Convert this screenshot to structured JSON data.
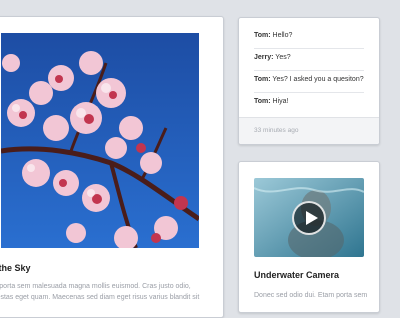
{
  "article": {
    "title": "ps in the Sky",
    "body_lines": [
      "Etam porta sem malesuada magna mollis euismod. Cras justo odio,",
      "n, egestas eget quam. Maecenas sed diam eget risus varius blandit sit"
    ]
  },
  "chat": {
    "messages": [
      {
        "sender": "Tom:",
        "text": " Hello?"
      },
      {
        "sender": "Jerry:",
        "text": " Yes?"
      },
      {
        "sender": "Tom:",
        "text": " Yes? I asked you a quesiton?"
      },
      {
        "sender": "Tom:",
        "text": " Hiya!"
      }
    ],
    "timestamp": "33 minutes ago"
  },
  "video": {
    "title": "Underwater Camera",
    "body": "Donec sed odio dui. Etam porta sem"
  },
  "colors": {
    "background": "#dfe2e7",
    "sky": "#1c4fa6",
    "blossom": "#f0c3d2"
  }
}
